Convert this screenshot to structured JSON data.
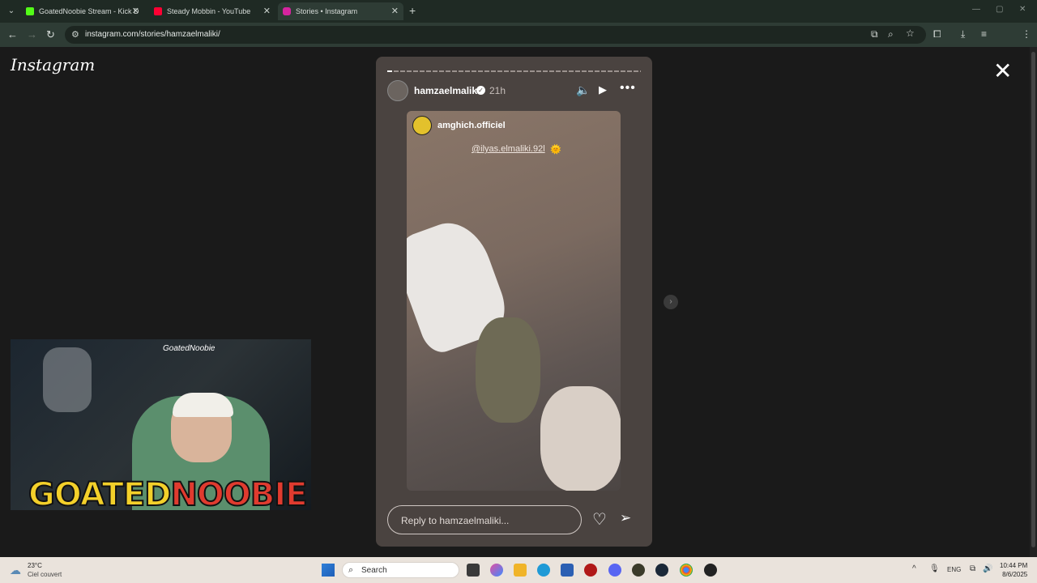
{
  "browser": {
    "tabs": [
      {
        "title": "GoatedNoobie Stream - Kick D",
        "color": "#53fc18"
      },
      {
        "title": "Steady Mobbin - YouTube",
        "color": "#ff0033"
      },
      {
        "title": "Stories • Instagram",
        "color": "#d6249f"
      }
    ],
    "url": "instagram.com/stories/hamzaelmaliki/"
  },
  "instagram": {
    "logo": "Instagram",
    "story": {
      "username": "hamzaelmaliki",
      "time_ago": "21h",
      "progress": 0.02,
      "reshared_from": "amghich.officiel",
      "mention": "@ilyas.elmaliki.92l",
      "mention_emoji": "🌞",
      "reply_placeholder": "Reply to hamzaelmaliki..."
    }
  },
  "webcam": {
    "tag": "GoatedNoobie",
    "banner_part1": "GOATED",
    "banner_part2": "NOOBIE"
  },
  "taskbar": {
    "weather_temp": "23°C",
    "weather_cond": "Ciel couvert",
    "search_label": "Search",
    "language": "ENG",
    "time": "10:44 PM",
    "date": "8/6/2025"
  }
}
